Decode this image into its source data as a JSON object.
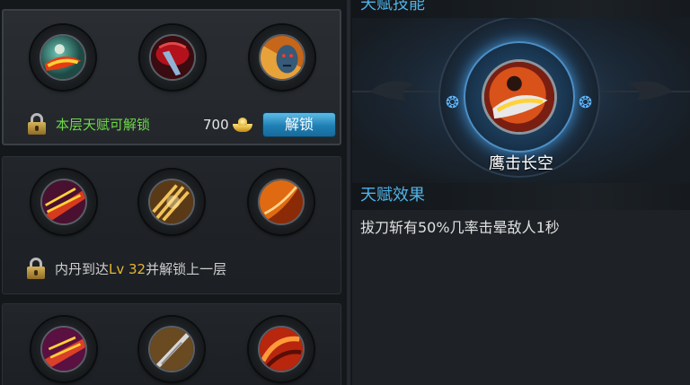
{
  "tiers": [
    {
      "state": "unlockable",
      "skills": [
        {
          "icon": "eagle-slash-skill-icon"
        },
        {
          "icon": "crimson-blade-skill-icon"
        },
        {
          "icon": "demon-face-skill-icon"
        }
      ],
      "lock_label": "本层天赋可解锁",
      "cost": "700",
      "unlock_button": "解锁"
    },
    {
      "state": "locked",
      "skills": [
        {
          "icon": "lightning-slash-skill-icon"
        },
        {
          "icon": "golden-claw-skill-icon"
        },
        {
          "icon": "flame-swirl-skill-icon"
        }
      ],
      "requirement_prefix": "内丹到达",
      "requirement_level": "Lv 32",
      "requirement_suffix": "并解锁上一层"
    },
    {
      "state": "locked",
      "skills": [
        {
          "icon": "purple-bolt-skill-icon"
        },
        {
          "icon": "silver-spike-skill-icon"
        },
        {
          "icon": "red-vortex-skill-icon"
        }
      ]
    }
  ],
  "detail": {
    "skills_header": "天赋技能",
    "selected_skill_name": "鹰击长空",
    "selected_skill_icon": "eagle-slash-skill-icon",
    "effect_header": "天赋效果",
    "effect_text": "拔刀斩有50%几率击晕敌人1秒"
  },
  "colors": {
    "accent_blue": "#4fb3e8",
    "unlock_green": "#6fd84a",
    "level_gold": "#e8b532"
  }
}
